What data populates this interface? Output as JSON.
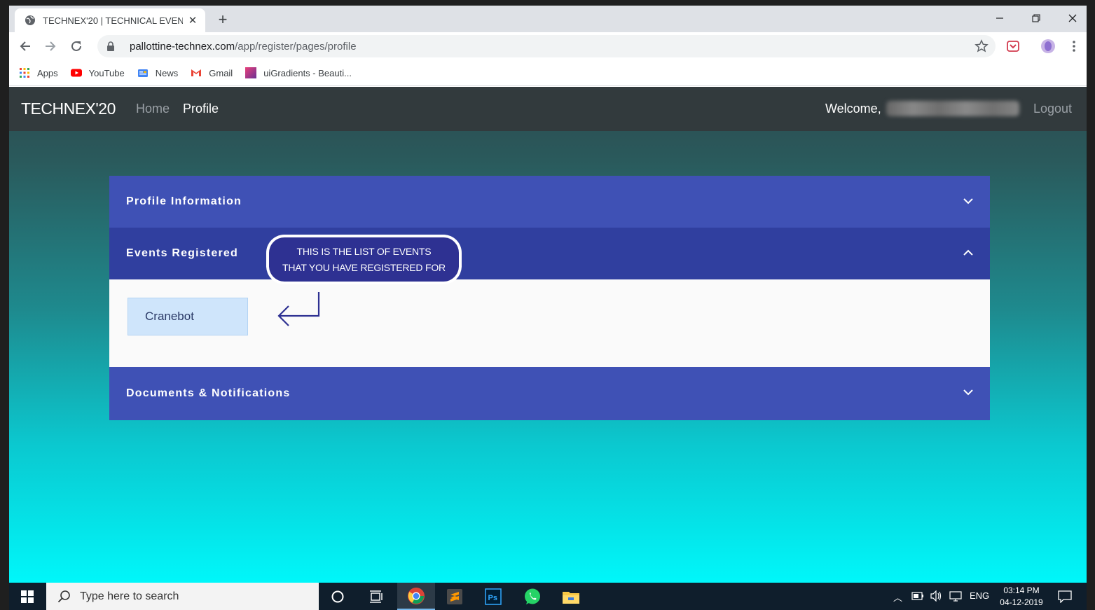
{
  "browser": {
    "tab_title": "TECHNEX'20 | TECHNICAL EVENTS",
    "url_host": "pallottine-technex.com",
    "url_path": "/app/register/pages/profile",
    "bookmarks": [
      {
        "label": "Apps",
        "icon": "apps-grid-icon"
      },
      {
        "label": "YouTube",
        "icon": "youtube-icon"
      },
      {
        "label": "News",
        "icon": "news-icon"
      },
      {
        "label": "Gmail",
        "icon": "gmail-icon"
      },
      {
        "label": "uiGradients - Beauti...",
        "icon": "uigradients-icon"
      }
    ]
  },
  "navbar": {
    "brand": "TECHNEX'20",
    "home": "Home",
    "profile": "Profile",
    "welcome": "Welcome,",
    "logout": "Logout"
  },
  "sections": {
    "profile_info": "Profile Information",
    "events_registered": "Events Registered",
    "documents": "Documents & Notifications"
  },
  "events": [
    "Cranebot"
  ],
  "callout": {
    "line1": "THIS IS THE LIST OF EVENTS",
    "line2": "THAT YOU HAVE REGISTERED FOR"
  },
  "taskbar": {
    "search_placeholder": "Type here to search",
    "language": "ENG",
    "time": "03:14 PM",
    "date": "04-12-2019"
  },
  "colors": {
    "accordion_header": "#3f51b5",
    "accordion_active": "#303f9f",
    "navbar": "#323a3d",
    "callout": "#2e3192"
  }
}
